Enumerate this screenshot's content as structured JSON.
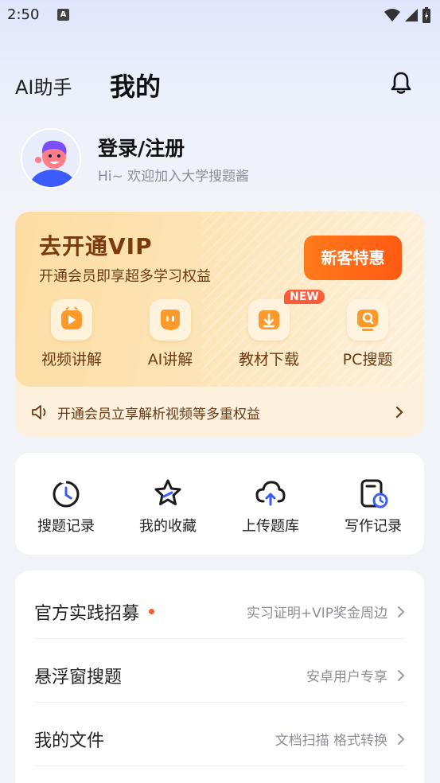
{
  "status_bar": {
    "time": "2:50",
    "notification_icon": "A"
  },
  "header": {
    "tab_ai": "AI助手",
    "tab_mine": "我的"
  },
  "profile": {
    "title": "登录/注册",
    "subtitle": "Hi~ 欢迎加入大学搜题酱"
  },
  "vip": {
    "title": "去开通VIP",
    "subtitle": "开通会员即享超多学习权益",
    "button": "新客特惠",
    "features": [
      {
        "label": "视频讲解",
        "icon": "video-play-icon"
      },
      {
        "label": "AI讲解",
        "icon": "ai-chat-icon"
      },
      {
        "label": "教材下载",
        "icon": "download-icon",
        "badge": "NEW"
      },
      {
        "label": "PC搜题",
        "icon": "pc-search-icon"
      }
    ],
    "notice": "开通会员立享解析视频等多重权益"
  },
  "quick_actions": [
    {
      "label": "搜题记录",
      "icon": "history-icon"
    },
    {
      "label": "我的收藏",
      "icon": "star-icon"
    },
    {
      "label": "上传题库",
      "icon": "cloud-upload-icon"
    },
    {
      "label": "写作记录",
      "icon": "writing-record-icon"
    }
  ],
  "menu": [
    {
      "label": "官方实践招募",
      "hint": "实习证明+VIP奖金周边",
      "dot": true
    },
    {
      "label": "悬浮窗搜题",
      "hint": "安卓用户专享"
    },
    {
      "label": "我的文件",
      "hint": "文档扫描 格式转换"
    }
  ],
  "colors": {
    "accent": "#ff5a14",
    "brand_blue": "#3b5bff",
    "vip_text": "#7a3a0c"
  }
}
